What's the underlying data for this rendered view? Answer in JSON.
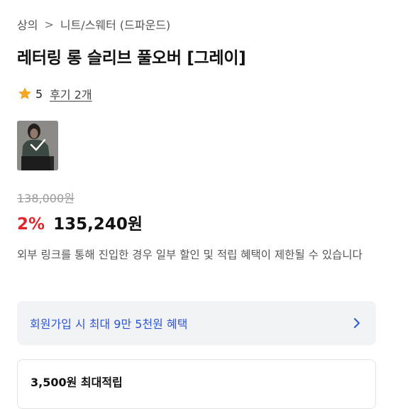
{
  "breadcrumb": {
    "items": [
      "상의",
      "니트/스웨터 (드파운드)"
    ],
    "separator": ">"
  },
  "product": {
    "title": "레터링 롱 슬리브 풀오버 [그레이]",
    "rating_score": "5",
    "review_link": "후기 2개",
    "thumbnail_icon": "check-icon"
  },
  "price": {
    "original": "138,000원",
    "discount": "2%",
    "sale": "135,240원"
  },
  "notice": "외부 링크를 통해 진입한 경우 일부 할인 및 적립 혜택이 제한될 수 있습니다",
  "benefit_banner": {
    "text": "회원가입 시 최대 9만 5천원 혜택"
  },
  "points": {
    "text": "3,500원 최대적립"
  },
  "colors": {
    "discount": "#e3242b",
    "link_blue": "#2c55d8",
    "star": "#f5a623",
    "banner_bg": "#f2f3f7"
  }
}
